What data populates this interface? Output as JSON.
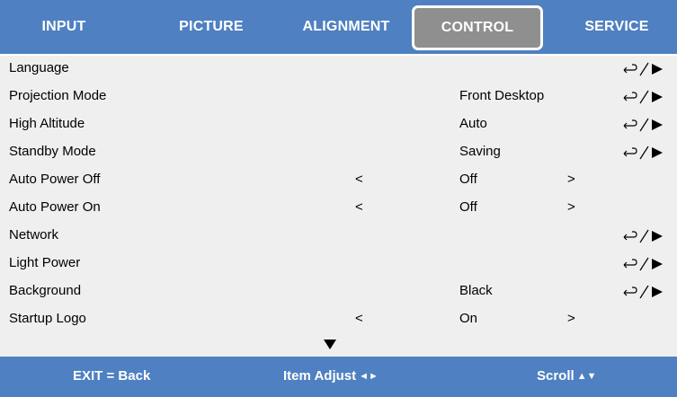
{
  "tabs": [
    {
      "label": "INPUT"
    },
    {
      "label": "PICTURE"
    },
    {
      "label": "ALIGNMENT"
    },
    {
      "label": "CONTROL",
      "selected": true
    },
    {
      "label": "SERVICE"
    }
  ],
  "menu": {
    "items": [
      {
        "label": "Language",
        "value": "",
        "type": "submenu"
      },
      {
        "label": "Projection Mode",
        "value": "Front Desktop",
        "type": "submenu"
      },
      {
        "label": "High Altitude",
        "value": "Auto",
        "type": "submenu"
      },
      {
        "label": "Standby Mode",
        "value": "Saving",
        "type": "submenu"
      },
      {
        "label": "Auto Power Off",
        "value": "Off",
        "type": "adjust",
        "left": "<",
        "right": ">"
      },
      {
        "label": "Auto Power On",
        "value": "Off",
        "type": "adjust",
        "left": "<",
        "right": ">"
      },
      {
        "label": "Network",
        "value": "",
        "type": "submenu"
      },
      {
        "label": "Light Power",
        "value": "",
        "type": "submenu"
      },
      {
        "label": "Background",
        "value": "Black",
        "type": "submenu"
      },
      {
        "label": "Startup Logo",
        "value": "On",
        "type": "adjust",
        "left": "<",
        "right": ">"
      }
    ],
    "more_icon": "scroll-down-triangle-icon",
    "submenu_icon": "enter-or-right-icon"
  },
  "footer": {
    "exit": "EXIT = Back",
    "adjust": "Item Adjust",
    "adjust_glyph": "◄►",
    "scroll": "Scroll",
    "scroll_glyph": "▲▼"
  },
  "colors": {
    "bar": "#4f80c1",
    "selected_tab": "#8f8f8f",
    "menu_bg": "#efefef",
    "text": "#000000",
    "bar_text": "#ffffff"
  }
}
